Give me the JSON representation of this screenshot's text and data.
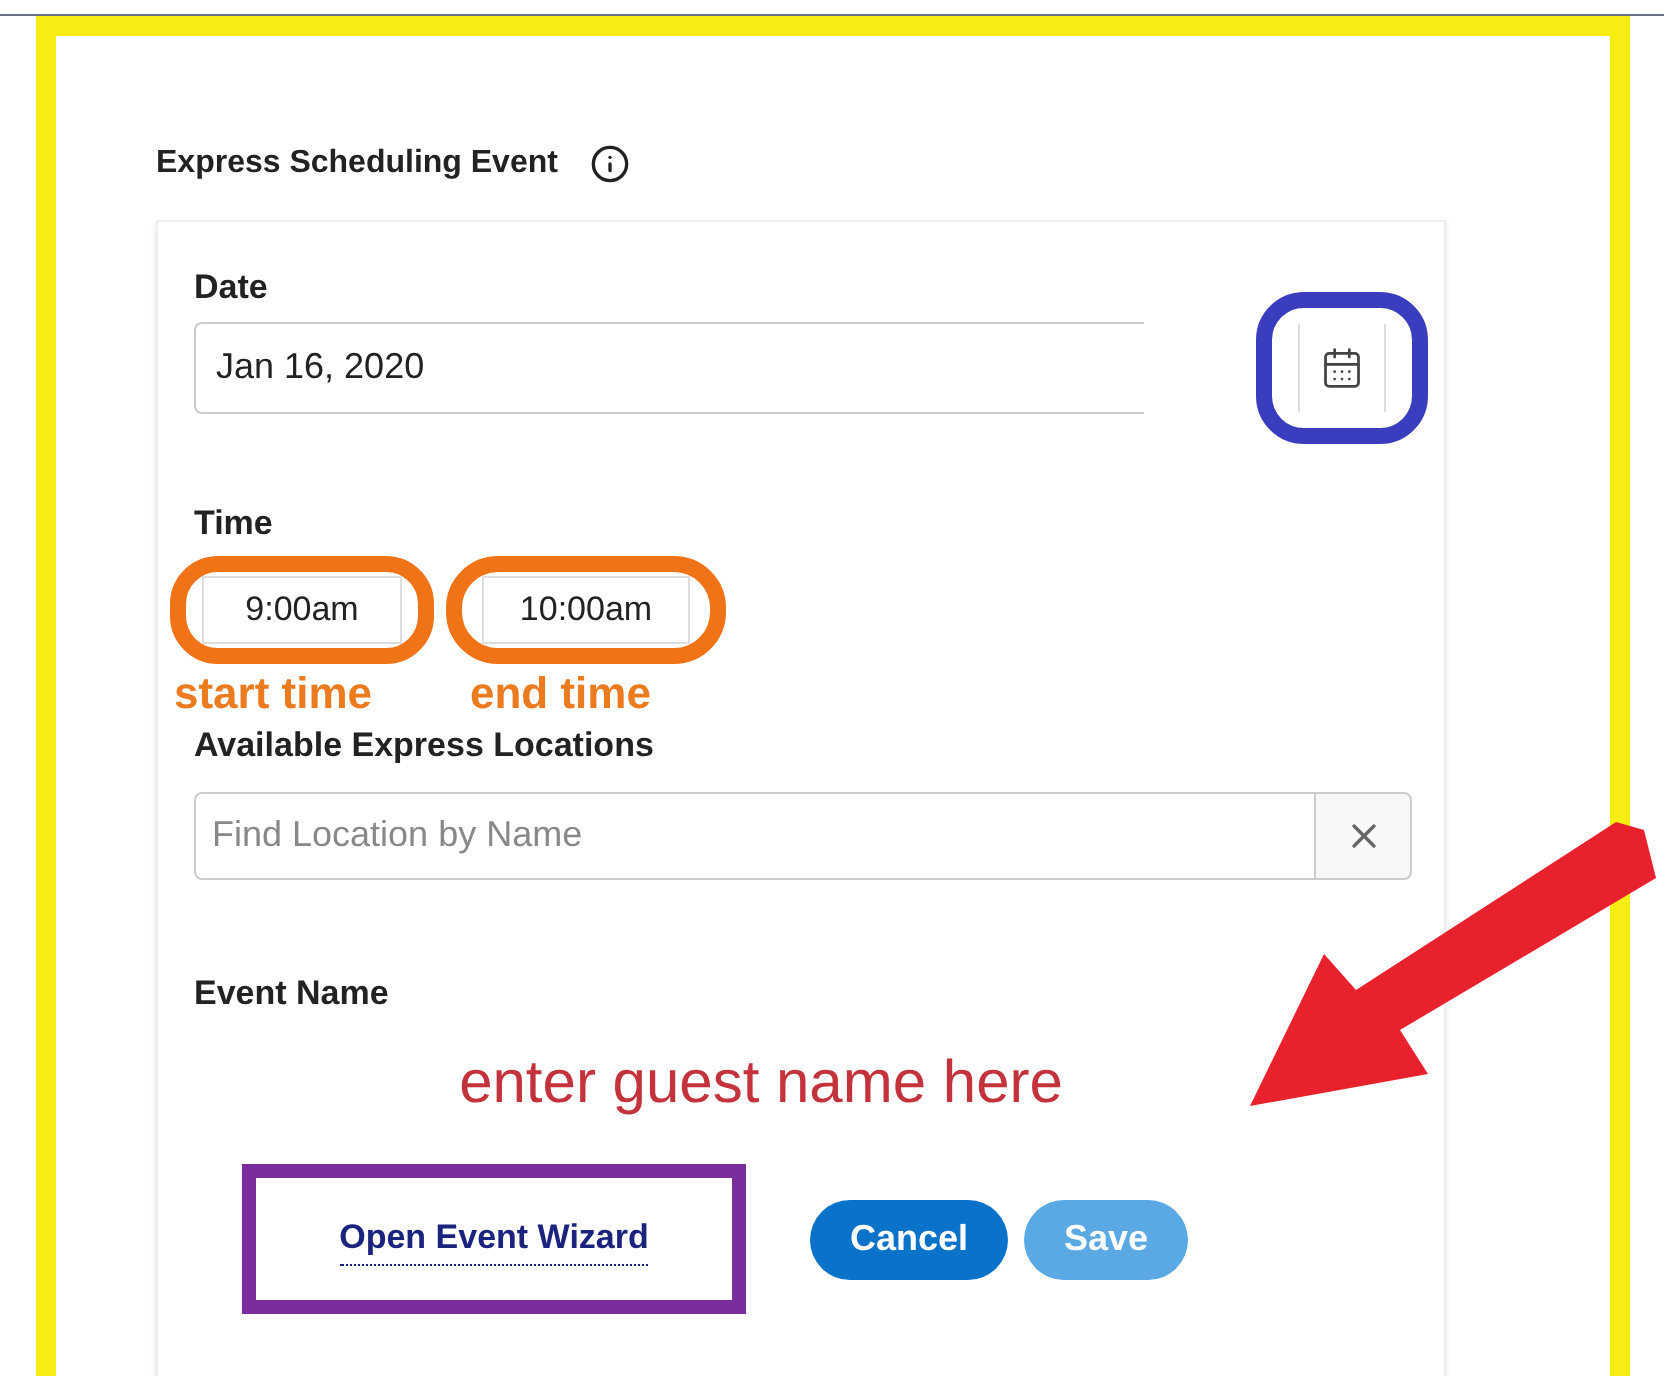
{
  "heading": "Express Scheduling Event",
  "date": {
    "label": "Date",
    "value": "Jan 16, 2020"
  },
  "time": {
    "label": "Time",
    "start": "9:00am",
    "end": "10:00am"
  },
  "locations": {
    "label": "Available Express Locations",
    "placeholder": "Find Location by Name"
  },
  "event_name": {
    "label": "Event Name"
  },
  "buttons": [
    {
      "label": "Open Event Wizard",
      "kind": "link",
      "disabled": false
    },
    {
      "label": "Cancel",
      "kind": "primary",
      "disabled": false
    },
    {
      "label": "Save",
      "kind": "primary",
      "disabled": true
    }
  ],
  "annotations": {
    "start_time": "start time",
    "end_time": "end time",
    "event_name_hint": "enter guest name here"
  }
}
